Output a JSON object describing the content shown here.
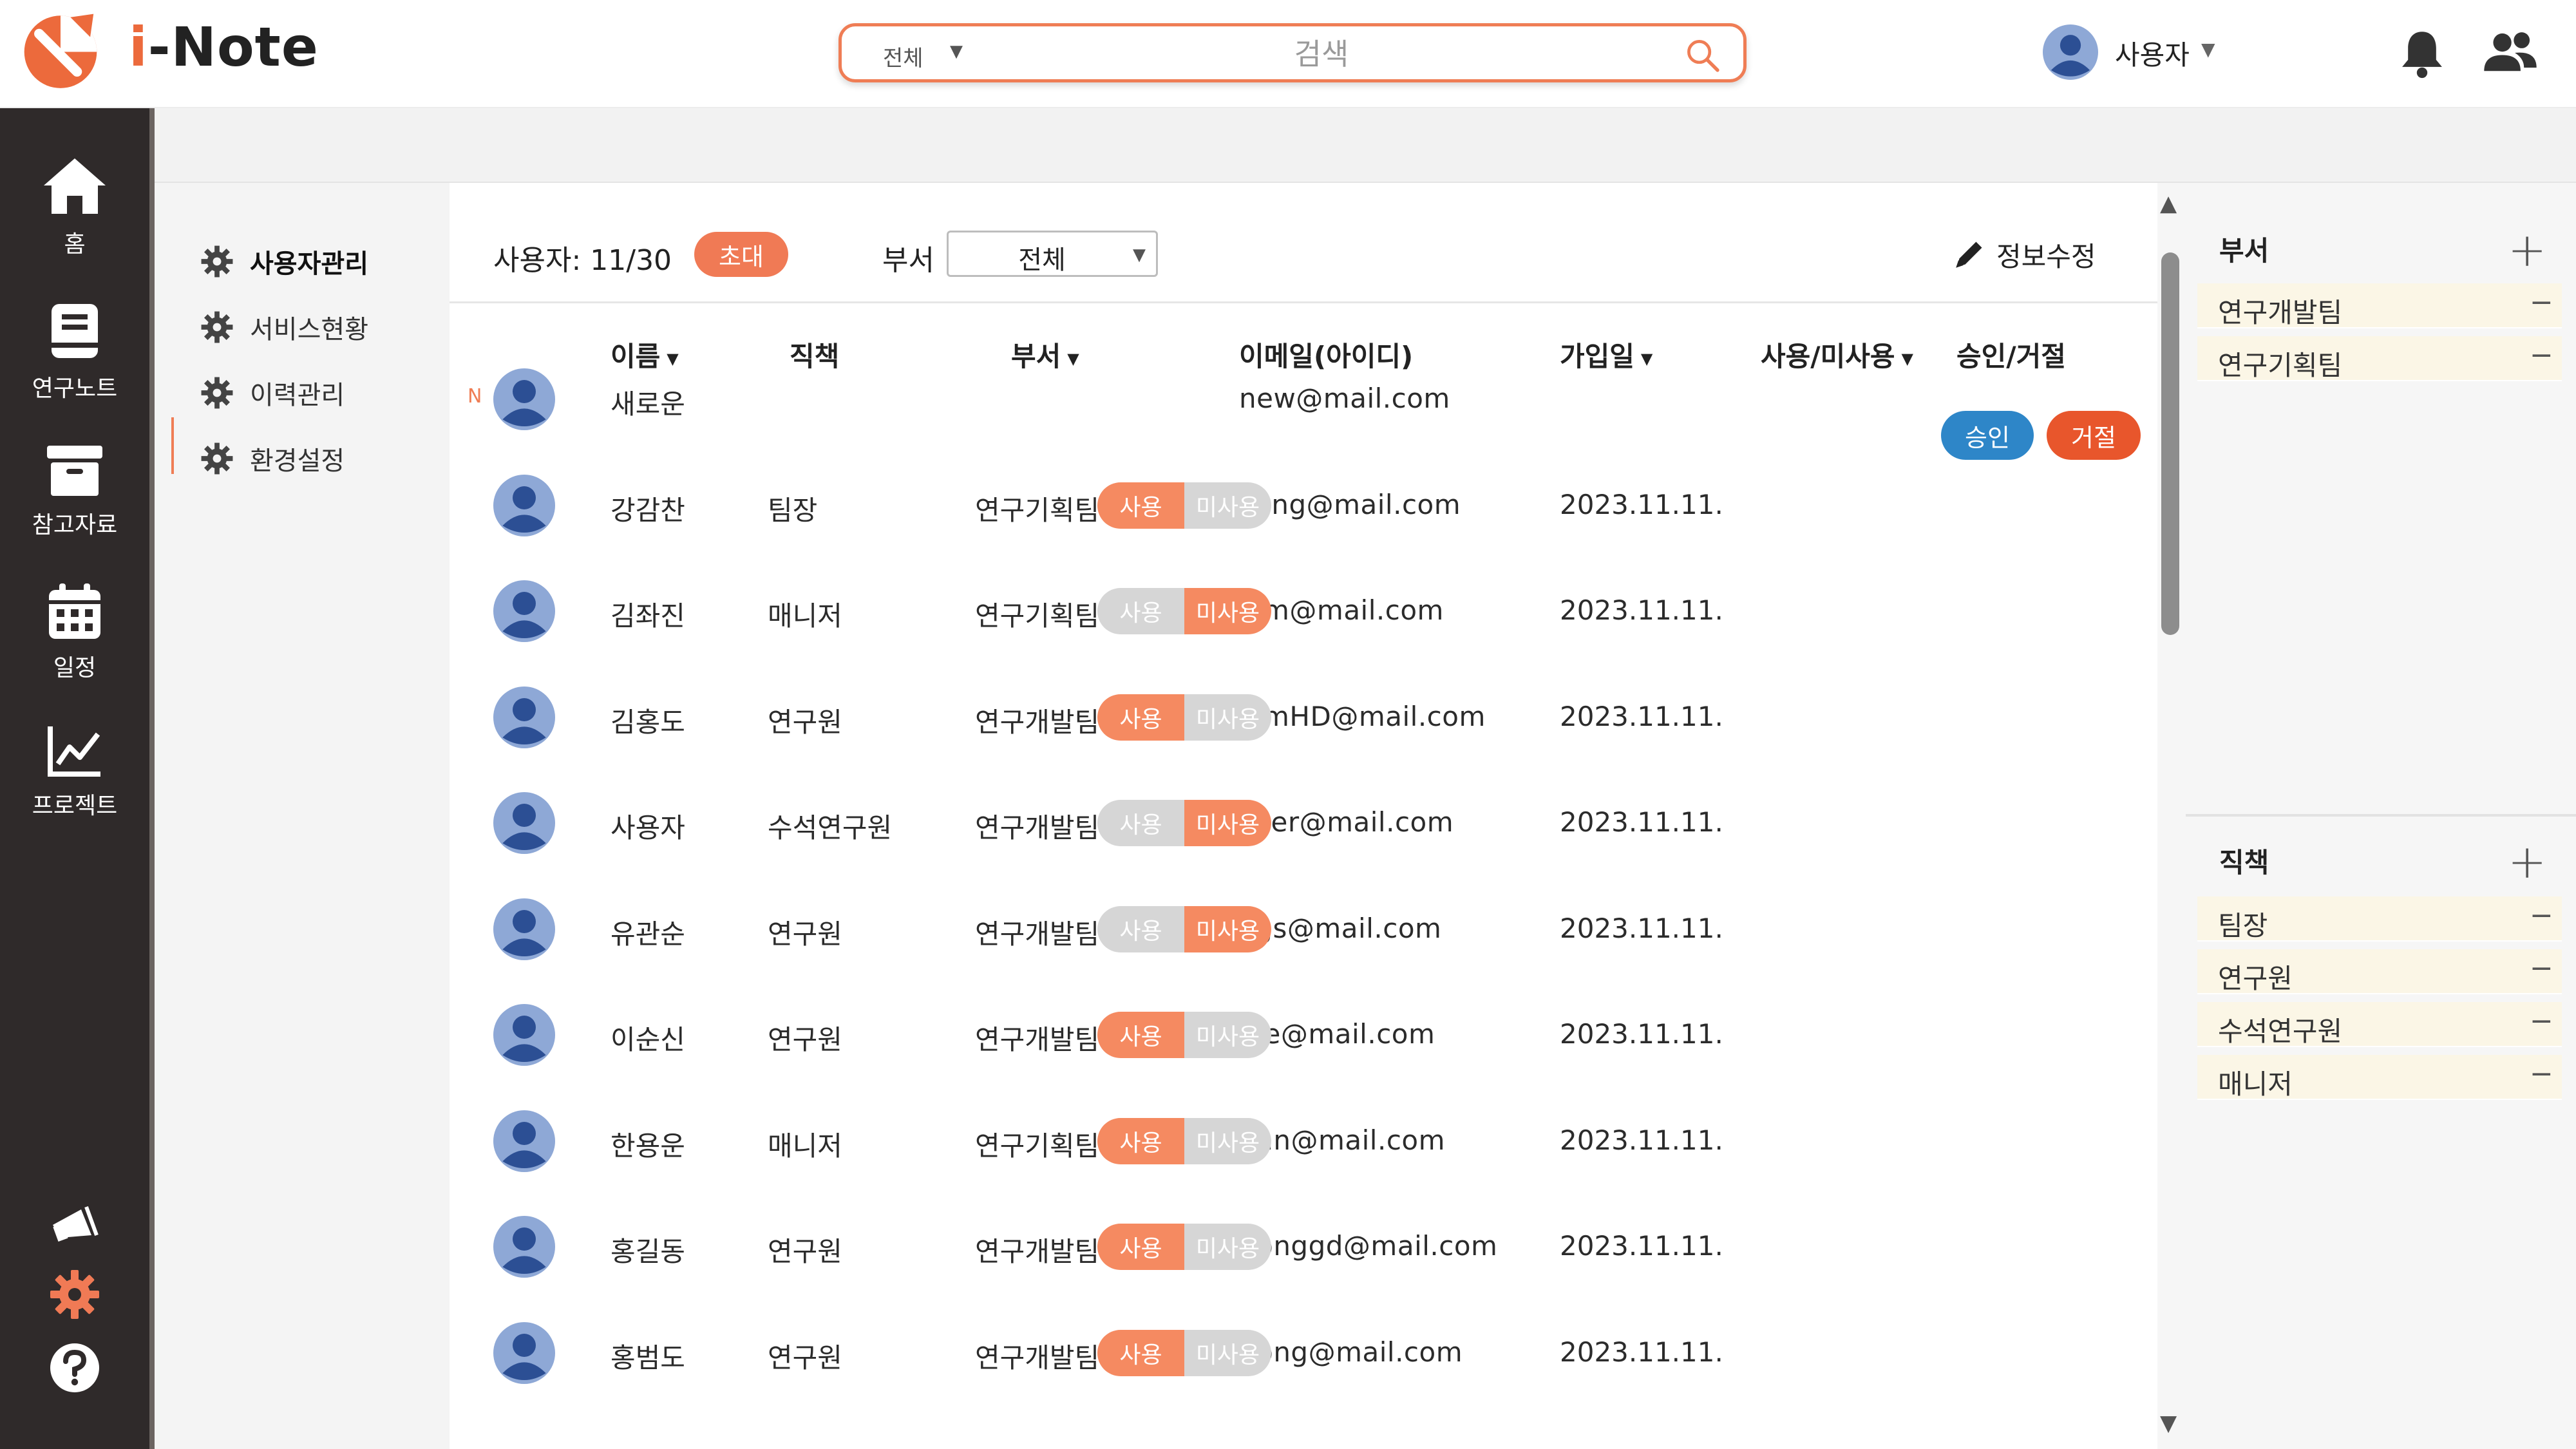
{
  "app": {
    "title_prefix": "i",
    "title_rest": "-Note"
  },
  "search": {
    "category": "전체",
    "placeholder": "검색",
    "value": ""
  },
  "user": {
    "name": "사용자"
  },
  "sidebar": {
    "items": [
      {
        "label": "홈",
        "icon": "home-icon"
      },
      {
        "label": "연구노트",
        "icon": "notebook-icon"
      },
      {
        "label": "참고자료",
        "icon": "archive-box-icon"
      },
      {
        "label": "일정",
        "icon": "calendar-icon"
      },
      {
        "label": "프로젝트",
        "icon": "line-chart-icon"
      }
    ],
    "bottom_icons": [
      "megaphone-icon",
      "gear-icon",
      "help-icon"
    ]
  },
  "submenu": {
    "items": [
      {
        "label": "사용자관리",
        "active": true
      },
      {
        "label": "서비스현황",
        "active": false
      },
      {
        "label": "이력관리",
        "active": false
      },
      {
        "label": "환경설정",
        "active": false
      }
    ]
  },
  "toolbar": {
    "user_count": "사용자:  11/30",
    "invite_label": "초대",
    "dept_label": "부서",
    "dept_value": "전체",
    "edit_label": "정보수정"
  },
  "table": {
    "headers": {
      "name": "이름",
      "position": "직책",
      "dept": "부서",
      "email": "이메일(아이디)",
      "joined": "가입일",
      "status": "사용/미사용",
      "approval": "승인/거절"
    },
    "toggle_on_label": "사용",
    "toggle_off_label": "미사용",
    "approve_label": "승인",
    "reject_label": "거절",
    "new_mark": "N",
    "rows": [
      {
        "name": "새로운",
        "position": "",
        "dept": "",
        "email": "new@mail.com",
        "joined": "",
        "status": "pending"
      },
      {
        "name": "강감찬",
        "position": "팀장",
        "dept": "연구기획팀",
        "email": "kang@mail.com",
        "joined": "2023.11.11.",
        "status": "on"
      },
      {
        "name": "김좌진",
        "position": "매니저",
        "dept": "연구기획팀",
        "email": "kim@mail.com",
        "joined": "2023.11.11.",
        "status": "off"
      },
      {
        "name": "김홍도",
        "position": "연구원",
        "dept": "연구개발팀",
        "email": "kimHD@mail.com",
        "joined": "2023.11.11.",
        "status": "on"
      },
      {
        "name": "사용자",
        "position": "수석연구원",
        "dept": "연구개발팀",
        "email": "user@mail.com",
        "joined": "2023.11.11.",
        "status": "off"
      },
      {
        "name": "유관순",
        "position": "연구원",
        "dept": "연구개발팀",
        "email": "ygs@mail.com",
        "joined": "2023.11.11.",
        "status": "off"
      },
      {
        "name": "이순신",
        "position": "연구원",
        "dept": "연구개발팀",
        "email": "lee@mail.com",
        "joined": "2023.11.11.",
        "status": "on"
      },
      {
        "name": "한용운",
        "position": "매니저",
        "dept": "연구기획팀",
        "email": "han@mail.com",
        "joined": "2023.11.11.",
        "status": "on"
      },
      {
        "name": "홍길동",
        "position": "연구원",
        "dept": "연구개발팀",
        "email": "honggd@mail.com",
        "joined": "2023.11.11.",
        "status": "on"
      },
      {
        "name": "홍범도",
        "position": "연구원",
        "dept": "연구개발팀",
        "email": "hong@mail.com",
        "joined": "2023.11.11.",
        "status": "on"
      }
    ]
  },
  "right_panel": {
    "departments": {
      "title": "부서",
      "items": [
        "연구개발팀",
        "연구기획팀"
      ]
    },
    "positions": {
      "title": "직책",
      "items": [
        "팀장",
        "연구원",
        "수석연구원",
        "매니저"
      ]
    }
  },
  "colors": {
    "accent": "#ef7d55",
    "sidebar": "#2f2a2a",
    "approve": "#2e86c8",
    "reject": "#e8562c",
    "avatar": "#4a6fb5"
  }
}
